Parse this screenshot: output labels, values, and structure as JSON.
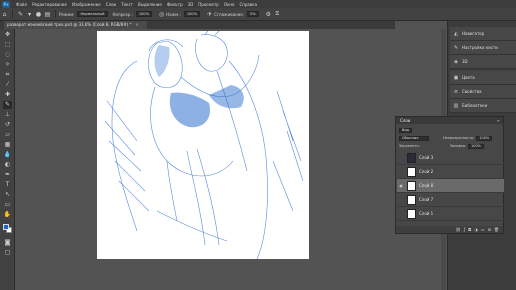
{
  "app": {
    "logo": "Ps"
  },
  "menu": [
    "Файл",
    "Редактирование",
    "Изображение",
    "Слои",
    "Текст",
    "Выделение",
    "Фильтр",
    "3D",
    "Просмотр",
    "Окно",
    "Справка"
  ],
  "options": {
    "mode_label": "Режим:",
    "mode_value": "Нормальный",
    "opacity_label": "Непрозр.:",
    "opacity_value": "100%",
    "flow_label": "Нажм.:",
    "flow_value": "100%",
    "smoothing_label": "Сглаживание:",
    "smoothing_value": "0%"
  },
  "document": {
    "tab_title": "разворот мэнвейский трех.psd @ 33,6% (Слой 8, RGB/8#) *",
    "close": "×"
  },
  "dock": [
    {
      "icon": "navigator-icon",
      "label": "Навигатор"
    },
    {
      "icon": "adjustments-icon",
      "label": "Настройка кисти"
    },
    {
      "icon": "3d-icon",
      "label": "3D"
    },
    {
      "icon": "color-icon",
      "label": "Цвета"
    },
    {
      "icon": "properties-icon",
      "label": "Свойства"
    },
    {
      "icon": "libraries-icon",
      "label": "Библиотеки"
    }
  ],
  "layers_panel": {
    "title": "Слои",
    "filter_label": "Вид",
    "blend_mode": "Обычные",
    "opacity_label": "Непрозрачность:",
    "opacity_value": "100%",
    "lock_label": "Закрепить:",
    "fill_label": "Заливка:",
    "fill_value": "100%",
    "layers": [
      {
        "name": "Слой 3",
        "visible": false,
        "selected": false,
        "thumb": "dark"
      },
      {
        "name": "Слой 2",
        "visible": false,
        "selected": false,
        "thumb": "light"
      },
      {
        "name": "Слой 8",
        "visible": true,
        "selected": true,
        "thumb": "light"
      },
      {
        "name": "Слой 7",
        "visible": false,
        "selected": false,
        "thumb": "light"
      },
      {
        "name": "Слой 1",
        "visible": false,
        "selected": false,
        "thumb": "light"
      }
    ]
  },
  "colors": {
    "foreground": "#1e66c9",
    "background": "#ffffff",
    "sketch_blue": "#3a78d6"
  }
}
